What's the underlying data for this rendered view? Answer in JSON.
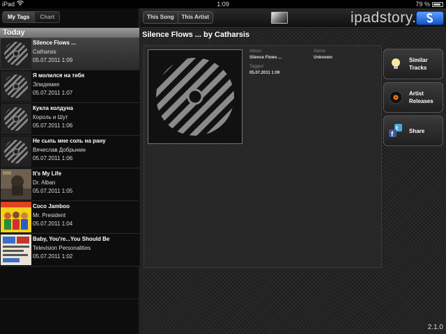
{
  "status": {
    "device": "iPad",
    "time": "1:09",
    "battery": "79 %"
  },
  "left": {
    "tabs": [
      "My Tags",
      "Chart"
    ],
    "section": "Today",
    "rows": [
      {
        "title": "Silence Flows ...",
        "artist": "Catharsis",
        "date": "05.07.2011 1:09"
      },
      {
        "title": "Я молился на тебя",
        "artist": "Элидемия",
        "date": "05.07.2011 1:07"
      },
      {
        "title": "Кукла колдуна",
        "artist": "Король и Шут",
        "date": "05.07.2011 1:06"
      },
      {
        "title": "Не сыпь мне соль на рану",
        "artist": "Вячеслав Добрынин",
        "date": "05.07.2011 1:06"
      },
      {
        "title": "It's My Life",
        "artist": "Dr. Alban",
        "date": "05.07.2011 1:05"
      },
      {
        "title": "Coco Jamboo",
        "artist": "Mr. President",
        "date": "05.07.2011 1:04"
      },
      {
        "title": "Baby, You're...You Should Be",
        "artist": "Television Personalities",
        "date": "05.07.2011 1:02"
      }
    ]
  },
  "top": {
    "tabs": [
      "This Song",
      "This Artist"
    ],
    "watermark": "ipadstory.ru",
    "shazam_icon": "shazam-s-icon"
  },
  "main": {
    "heading": "Silence Flows ... by Catharsis",
    "album_label": "Album",
    "album": "Silence Flows ...",
    "genre_label": "Genre",
    "genre": "Unknown",
    "tagged_label": "Tagged",
    "tagged": "05.07.2011 1:09",
    "actions": [
      {
        "line1": "Similar",
        "line2": "Tracks",
        "icon": "lightbulb-icon"
      },
      {
        "line1": "Artist",
        "line2": "Releases",
        "icon": "vinyl-icon"
      },
      {
        "line1": "Share",
        "line2": "",
        "icon": "social-share-icon"
      }
    ]
  },
  "version": "2.1.0"
}
